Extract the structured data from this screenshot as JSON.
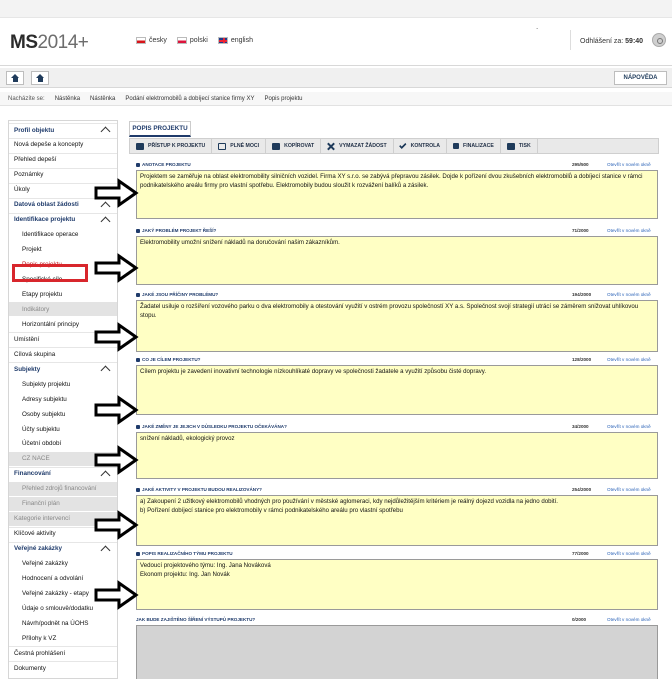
{
  "app": {
    "logo_prefix": "MS",
    "logo_year": "2014+"
  },
  "languages": [
    {
      "code": "cz",
      "label": "česky"
    },
    {
      "code": "pl",
      "label": "polski"
    },
    {
      "code": "en",
      "label": "english"
    }
  ],
  "header": {
    "dots": ".",
    "logout_label": "Odhlášení za:",
    "logout_time": "59:40"
  },
  "nav": {
    "help_label": "NÁPOVĚDA"
  },
  "breadcrumb": {
    "label": "Nacházíte se:",
    "items": [
      "Nástěnka",
      "Nástěnka",
      "Podání elektromobilů a dobíjecí stanice firmy XY",
      "Popis projektu"
    ]
  },
  "sidebar": {
    "items": [
      {
        "label": "Profil objektu",
        "type": "section",
        "chevron": true
      },
      {
        "label": "Nová depeše a koncepty",
        "type": "item"
      },
      {
        "label": "Přehled depeší",
        "type": "item"
      },
      {
        "label": "Poznámky",
        "type": "item"
      },
      {
        "label": "Úkoly",
        "type": "item"
      },
      {
        "label": "Datová oblast žádosti",
        "type": "section",
        "chevron": true
      },
      {
        "label": "Identifikace projektu",
        "type": "section",
        "chevron": true
      },
      {
        "label": "Identifikace operace",
        "type": "sub"
      },
      {
        "label": "Projekt",
        "type": "sub"
      },
      {
        "label": "Popis projektu",
        "type": "sub-active"
      },
      {
        "label": "Specifické cíle",
        "type": "sub"
      },
      {
        "label": "Etapy projektu",
        "type": "sub"
      },
      {
        "label": "Indikátory",
        "type": "sub-disabled"
      },
      {
        "label": "Horizontální principy",
        "type": "sub"
      },
      {
        "label": "Umístění",
        "type": "item"
      },
      {
        "label": "Cílová skupina",
        "type": "item"
      },
      {
        "label": "Subjekty",
        "type": "section",
        "chevron": true
      },
      {
        "label": "Subjekty projektu",
        "type": "sub"
      },
      {
        "label": "Adresy subjektu",
        "type": "sub"
      },
      {
        "label": "Osoby subjektu",
        "type": "sub"
      },
      {
        "label": "Účty subjektu",
        "type": "sub"
      },
      {
        "label": "Účetní období",
        "type": "sub"
      },
      {
        "label": "CZ NACE",
        "type": "sub-disabled"
      },
      {
        "label": "Financování",
        "type": "section",
        "chevron": true
      },
      {
        "label": "Přehled zdrojů financování",
        "type": "sub-disabled"
      },
      {
        "label": "Finanční plán",
        "type": "sub-disabled"
      },
      {
        "label": "Kategorie intervencí",
        "type": "disabled"
      },
      {
        "label": "Klíčové aktivity",
        "type": "item"
      },
      {
        "label": "Veřejné zakázky",
        "type": "section",
        "chevron": true
      },
      {
        "label": "Veřejné zakázky",
        "type": "sub"
      },
      {
        "label": "Hodnocení a odvolání",
        "type": "sub"
      },
      {
        "label": "Veřejné zakázky - etapy",
        "type": "sub"
      },
      {
        "label": "Údaje o smlouvě/dodatku",
        "type": "sub"
      },
      {
        "label": "Návrh/podnět na ÚOHS",
        "type": "sub"
      },
      {
        "label": "Přílohy k VZ",
        "type": "sub"
      },
      {
        "label": "Čestná prohlášení",
        "type": "item"
      },
      {
        "label": "Dokumenty",
        "type": "item"
      }
    ]
  },
  "main": {
    "tab_title": "POPIS PROJEKTU",
    "toolbar": [
      {
        "label": "PŘÍSTUP K PROJEKTU",
        "icon": "users-icon"
      },
      {
        "label": "PLNÉ MOCI",
        "icon": "mail-icon"
      },
      {
        "label": "KOPÍROVAT",
        "icon": "copy-icon"
      },
      {
        "label": "VYMAZAT ŽÁDOST",
        "icon": "delete-icon"
      },
      {
        "label": "KONTROLA",
        "icon": "check-icon"
      },
      {
        "label": "FINALIZACE",
        "icon": "lock-icon"
      },
      {
        "label": "TISK",
        "icon": "print-icon"
      }
    ],
    "fields": [
      {
        "label": "ANOTACE PROJEKTU",
        "count": "295/500",
        "link": "Otevřít v novém okně",
        "value": "Projektem se zaměřuje na oblast elektromobility silničních vozidel. Firma XY s.r.o. se zabývá přepravou zásilek. Dojde k pořízení dvou zkušebních elektromobilů a dobíjecí stanice v rámci podnikatelského areálu firmy pro vlastní spotřebu. Elektromobily budou sloužit k rozvážení balíků a zásilek."
      },
      {
        "label": "JAKÝ PROBLÉM PROJEKT ŘEŠÍ?",
        "count": "71/2000",
        "link": "Otevřít v novém okně",
        "value": "Elektromobility umožní snížení nákladů na doručování našim zákazníkům."
      },
      {
        "label": "JAKÉ JSOU PŘÍČINY PROBLÉMU?",
        "count": "194/2000",
        "link": "Otevřít v novém okně",
        "value": "Žadatel usiluje o rozšíření vozového parku o dva elektromobily a otestování využití v ostrém provozu společností XY a.s. Společnost svojí strategií utrácí se záměrem snižovat uhlíkovou stopu."
      },
      {
        "label": "CO JE CÍLEM PROJEKTU?",
        "count": "128/2000",
        "link": "Otevřít v novém okně",
        "value": "Cílem projektu je zavedení inovativní technologie nízkouhlíkaté dopravy ve společnosti žadatele a využití způsobu čisté dopravy."
      },
      {
        "label": "JAKÉ ZMĚNY JE JEJICH V DŮSLEDKU PROJEKTU OČEKÁVÁNA?",
        "count": "34/2000",
        "link": "Otevřít v novém okně",
        "value": "snížení nákladů, ekologický provoz"
      },
      {
        "label": "JAKÉ AKTIVITY V PROJEKTU BUDOU REALIZOVÁNY?",
        "count": "254/2000",
        "link": "Otevřít v novém okně",
        "value": "a) Zakoupení 2 užitkový elektromobilů vhodných pro používání v městské aglomeraci, kdy nejdůležitějším kritériem je reálný dojezd vozidla na jedno dobití.\nb) Pořízení dobíjecí stanice pro elektromobily v rámci podnikatelského areálu pro vlastní spotřebu"
      },
      {
        "label": "POPIS REALIZAČNÍHO TÝMU PROJEKTU",
        "count": "77/2000",
        "link": "Otevřít v novém okně",
        "value": "Vedoucí projektového týmu: Ing. Jana Nováková\nEkonom projektu: Ing. Jan Novák"
      },
      {
        "label": "JAK BUDE ZAJIŠTĚNO ŠÍŘENÍ VÝSTUPŮ PROJEKTU?",
        "count": "0/2000",
        "link": "Otevřít v novém okně",
        "value": ""
      }
    ]
  }
}
